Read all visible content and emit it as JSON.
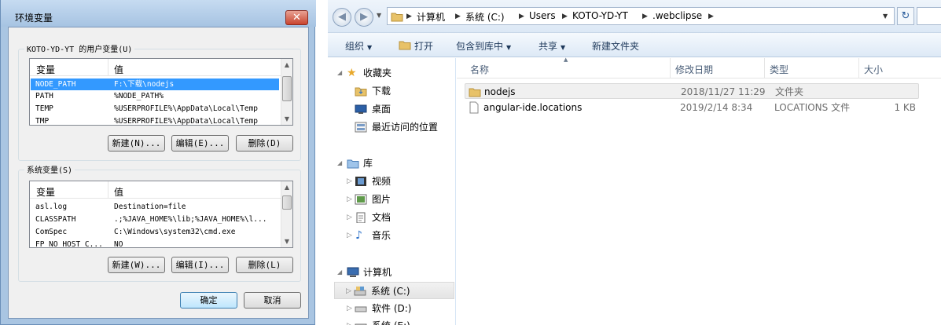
{
  "dialog": {
    "title": "环境变量",
    "close_glyph": "✕",
    "user_group_label": "KOTO-YD-YT 的用户变量(U)",
    "system_group_label": "系统变量(S)",
    "col_var": "变量",
    "col_val": "值",
    "user_vars": [
      {
        "name": "NODE_PATH",
        "value": "F:\\下载\\nodejs",
        "selected": true
      },
      {
        "name": "PATH",
        "value": "%NODE_PATH%"
      },
      {
        "name": "TEMP",
        "value": "%USERPROFILE%\\AppData\\Local\\Temp"
      },
      {
        "name": "TMP",
        "value": "%USERPROFILE%\\AppData\\Local\\Temp"
      }
    ],
    "system_vars": [
      {
        "name": "asl.log",
        "value": "Destination=file"
      },
      {
        "name": "CLASSPATH",
        "value": ".;%JAVA_HOME%\\lib;%JAVA_HOME%\\l..."
      },
      {
        "name": "ComSpec",
        "value": "C:\\Windows\\system32\\cmd.exe"
      },
      {
        "name": "FP_NO_HOST_C...",
        "value": "NO"
      }
    ],
    "user_buttons": {
      "new": "新建(N)...",
      "edit": "编辑(E)...",
      "delete": "删除(D)"
    },
    "system_buttons": {
      "new": "新建(W)...",
      "edit": "编辑(I)...",
      "delete": "删除(L)"
    },
    "ok": "确定",
    "cancel": "取消"
  },
  "explorer": {
    "breadcrumb": [
      "计算机",
      "系统 (C:)",
      "Users",
      "KOTO-YD-YT",
      ".webclipse"
    ],
    "toolbar": {
      "organize": "组织",
      "open": "打开",
      "include": "包含到库中",
      "share": "共享",
      "new_folder": "新建文件夹"
    },
    "nav": {
      "favorites": "收藏夹",
      "downloads": "下载",
      "desktop": "桌面",
      "recent": "最近访问的位置",
      "libraries": "库",
      "videos": "视频",
      "pictures": "图片",
      "documents": "文档",
      "music": "音乐",
      "computer": "计算机",
      "c_drive": "系统 (C:)",
      "d_drive": "软件 (D:)",
      "e_drive": "系统 (E:)"
    },
    "columns": {
      "name": "名称",
      "modified": "修改日期",
      "type": "类型",
      "size": "大小"
    },
    "files": [
      {
        "name": "nodejs",
        "modified": "2018/11/27 11:29",
        "type": "文件夹",
        "size": "",
        "icon": "folder-icon"
      },
      {
        "name": "angular-ide.locations",
        "modified": "2019/2/14 8:34",
        "type": "LOCATIONS 文件",
        "size": "1 KB",
        "icon": "file-icon"
      }
    ]
  },
  "colors": {
    "selection": "#3399ff",
    "titlebar": "#a6c3e2",
    "folder": "#e8c268"
  }
}
